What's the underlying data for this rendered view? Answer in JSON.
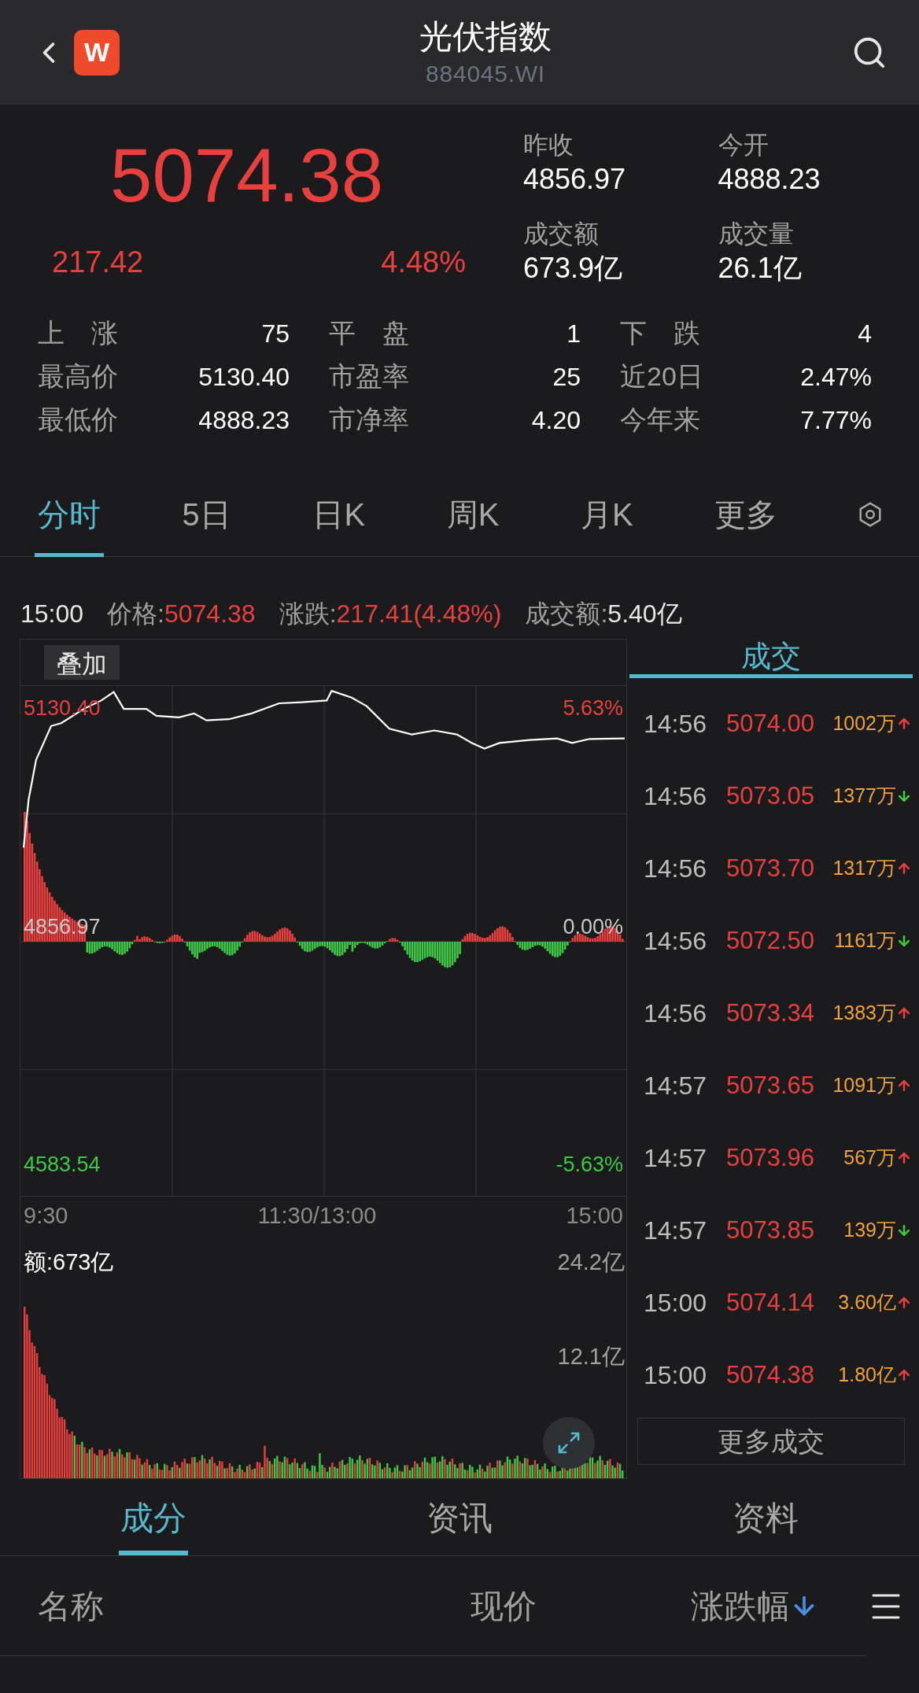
{
  "header": {
    "title": "光伏指数",
    "code": "884045.WI",
    "logo_text": "W"
  },
  "quote": {
    "price": "5074.38",
    "change": "217.42",
    "change_pct": "4.48%",
    "stats": [
      {
        "label": "昨收",
        "value": "4856.97"
      },
      {
        "label": "今开",
        "value": "4888.23"
      },
      {
        "label": "成交额",
        "value": "673.9亿"
      },
      {
        "label": "成交量",
        "value": "26.1亿"
      }
    ],
    "grid": [
      [
        {
          "label": "上　涨",
          "value": "75"
        },
        {
          "label": "平　盘",
          "value": "1"
        },
        {
          "label": "下　跌",
          "value": "4"
        }
      ],
      [
        {
          "label": "最高价",
          "value": "5130.40"
        },
        {
          "label": "市盈率",
          "value": "25"
        },
        {
          "label": "近20日",
          "value": "2.47%"
        }
      ],
      [
        {
          "label": "最低价",
          "value": "4888.23"
        },
        {
          "label": "市净率",
          "value": "4.20"
        },
        {
          "label": "今年来",
          "value": "7.77%"
        }
      ]
    ]
  },
  "chart_tabs": [
    {
      "label": "分时",
      "selected": true
    },
    {
      "label": "5日",
      "selected": false
    },
    {
      "label": "日K",
      "selected": false
    },
    {
      "label": "周K",
      "selected": false
    },
    {
      "label": "月K",
      "selected": false
    },
    {
      "label": "更多",
      "selected": false
    }
  ],
  "info_bar": {
    "time": "15:00",
    "items": [
      {
        "label": "价格:",
        "value": "5074.38",
        "rising": true
      },
      {
        "label": "涨跌:",
        "value": "217.41(4.48%)",
        "rising": true
      },
      {
        "label": "成交额:",
        "value": "5.40亿",
        "rising": false
      }
    ]
  },
  "price_chart": {
    "overlay_button": "叠加",
    "price_labels": [
      "5130.40",
      "4856.97",
      "4583.54"
    ],
    "pct_labels": [
      "5.63%",
      "0.00%",
      "-5.63%"
    ],
    "time_labels": [
      "9:30",
      "11:30/13:00",
      "15:00"
    ]
  },
  "volume_chart": {
    "amount_label": "额:673亿",
    "scale_labels": [
      "24.2亿",
      "12.1亿"
    ]
  },
  "trades": {
    "title": "成交",
    "more_button": "更多成交",
    "rows": [
      {
        "time": "14:56",
        "price": "5074.00",
        "volume": "1002万",
        "up": true
      },
      {
        "time": "14:56",
        "price": "5073.05",
        "volume": "1377万",
        "up": false
      },
      {
        "time": "14:56",
        "price": "5073.70",
        "volume": "1317万",
        "up": true
      },
      {
        "time": "14:56",
        "price": "5072.50",
        "volume": "1161万",
        "up": false
      },
      {
        "time": "14:56",
        "price": "5073.34",
        "volume": "1383万",
        "up": true
      },
      {
        "time": "14:57",
        "price": "5073.65",
        "volume": "1091万",
        "up": true
      },
      {
        "time": "14:57",
        "price": "5073.96",
        "volume": "567万",
        "up": true
      },
      {
        "time": "14:57",
        "price": "5073.85",
        "volume": "139万",
        "up": false
      },
      {
        "time": "15:00",
        "price": "5074.14",
        "volume": "3.60亿",
        "up": true
      },
      {
        "time": "15:00",
        "price": "5074.38",
        "volume": "1.80亿",
        "up": true
      }
    ]
  },
  "bottom_tabs": [
    {
      "label": "成分",
      "selected": true
    },
    {
      "label": "资讯",
      "selected": false
    },
    {
      "label": "资料",
      "selected": false
    }
  ],
  "table": {
    "columns": [
      {
        "label": "名称",
        "sorted_desc": false
      },
      {
        "label": "现价",
        "sorted_desc": false
      },
      {
        "label": "涨跌幅",
        "sorted_desc": true
      }
    ]
  }
}
